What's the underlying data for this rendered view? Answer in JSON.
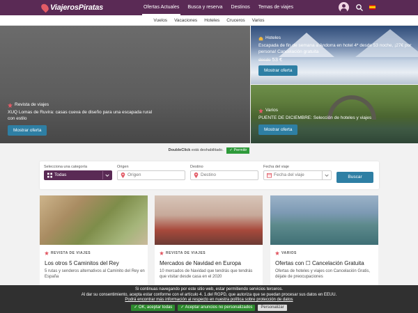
{
  "header": {
    "logo_text": "ViajerosPiratas",
    "nav": [
      "Ofertas Actuales",
      "Busca y reserva",
      "Destinos",
      "Temas de viajes"
    ],
    "active_nav": 0
  },
  "subnav": [
    "Vuelos",
    "Vacaciones",
    "Hoteles",
    "Cruceros",
    "Varios"
  ],
  "hero": {
    "main": {
      "category": "Revista de viajes",
      "text": "XUQ Lomas de Ruvira: casas cueva de diseño para una escapada rural con estilo",
      "button": "Mostrar oferta"
    },
    "side_top": {
      "category": "Hoteles",
      "text": "Escapada de fin de semana a Andorra en hotel 4* desde 53 noche, ¡27€ por persona! Cancelación gratuita",
      "price_prefix": "desde",
      "price": "53 €",
      "button": "Mostrar oferta"
    },
    "side_bottom": {
      "category": "Varios",
      "text": "PUENTE DE DICIEMBRE: Selección de hoteles y viajes",
      "button": "Mostrar oferta"
    }
  },
  "notice": {
    "brand": "DoubleClick",
    "text": "está deshabilitado.",
    "allow": "✓ Permitir"
  },
  "search": {
    "category_label": "Selecciona una categoría",
    "category_value": "Todas",
    "origin_label": "Origen",
    "origin_placeholder": "Origen",
    "dest_label": "Destino",
    "dest_placeholder": "Destino",
    "date_label": "Fecha del viaje",
    "date_placeholder": "Fecha del viaje",
    "submit": "Buscar"
  },
  "cards": [
    {
      "category": "REVISTA DE VIAJES",
      "title": "Los otros 5 Caminitos del Rey",
      "desc": "5 rutas y senderos alternativos al Caminito del Rey en España"
    },
    {
      "category": "REVISTA DE VIAJES",
      "title": "Mercados de Navidad en Europa",
      "desc": "10 mercados de Navidad que tendrás que tendrás que visitar desde casa en el 2020"
    },
    {
      "category": "VARIOS",
      "title": "Ofertas con ☐ Cancelación Gratuita",
      "desc": "Ofertas de hoteles y viajes con Cancelación Gratis, déjate de preocupaciones"
    }
  ],
  "cookie": {
    "line1": "Si continuas navegando por este sitio web, estar permitiendo servicios terceros.",
    "line2": "Al dar su consentimiento, acepta estar conforme con el artículo 4. 1.del RGPD, que autoriza que se puedan procesar sus datos en EEUU.",
    "line3": "Podrá encontrar más información al respecto en nuestra política sobre protección de datos",
    "accept_all": "✓ OK, aceptar todas",
    "accept_non_personal": "✓ Aceptar anuncios no personalizados",
    "customize": "Personalizar"
  },
  "colors": {
    "brand_purple": "#5a2a55",
    "button_blue": "#2e7fa4",
    "accent_red": "#e25b66",
    "allow_green": "#2e9a3a"
  },
  "icons": {
    "logo": "pirate-logo-icon",
    "search": "search-icon",
    "flag": "spain-flag-icon",
    "category": "star-badge-icon",
    "hotel": "hotel-icon",
    "pin": "location-pin-icon",
    "calendar": "calendar-icon",
    "grid": "grid-icon",
    "chevron": "chevron-down-icon"
  }
}
